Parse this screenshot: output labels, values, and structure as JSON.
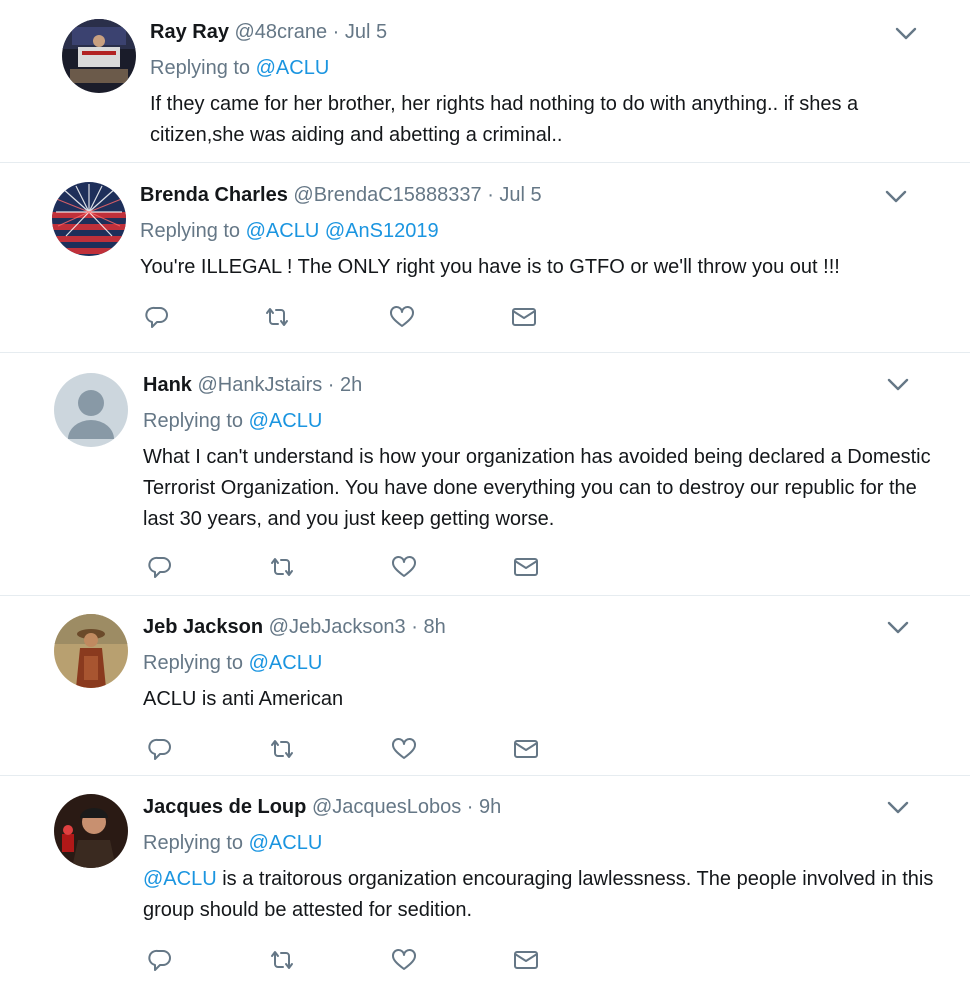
{
  "tweets": [
    {
      "name": "Ray Ray",
      "handle": "@48crane",
      "sep": " · ",
      "time": "Jul 5",
      "replying_prefix": "Replying to ",
      "mentions": [
        "@ACLU"
      ],
      "text_mention": "",
      "text": "If they came for her brother, her rights had nothing to do with anything.. if shes a citizen,she was aiding and abetting a criminal.."
    },
    {
      "name": "Brenda Charles",
      "handle": "@BrendaC15888337",
      "sep": " · ",
      "time": "Jul 5",
      "replying_prefix": "Replying to ",
      "mentions": [
        "@ACLU",
        "@AnS12019"
      ],
      "text_mention": "",
      "text": "You're ILLEGAL ! The ONLY right you have is to GTFO or we'll throw you out !!!"
    },
    {
      "name": "Hank",
      "handle": "@HankJstairs",
      "sep": " · ",
      "time": "2h",
      "replying_prefix": "Replying to ",
      "mentions": [
        "@ACLU"
      ],
      "text_mention": "",
      "text": "What I can't understand is how your organization has avoided being declared a Domestic Terrorist Organization.  You have done everything you can to destroy our republic for the last 30 years, and you just keep getting worse."
    },
    {
      "name": "Jeb Jackson",
      "handle": "@JebJackson3",
      "sep": " · ",
      "time": "8h",
      "replying_prefix": "Replying to ",
      "mentions": [
        "@ACLU"
      ],
      "text_mention": "",
      "text": "ACLU is anti American"
    },
    {
      "name": "Jacques de Loup",
      "handle": "@JacquesLobos",
      "sep": " · ",
      "time": "9h",
      "replying_prefix": "Replying to ",
      "mentions": [
        "@ACLU"
      ],
      "text_mention": "@ACLU",
      "text": " is a traitorous organization encouraging lawlessness. The people involved in this group should be attested for sedition."
    }
  ],
  "icons": {
    "reply": "reply-icon",
    "retweet": "retweet-icon",
    "like": "heart-icon",
    "dm": "envelope-icon",
    "caret": "chevron-down-icon"
  },
  "colors": {
    "mention": "#1b95e0",
    "secondary_text": "#657786",
    "icon": "#657786",
    "divider": "#e6ecf0"
  }
}
